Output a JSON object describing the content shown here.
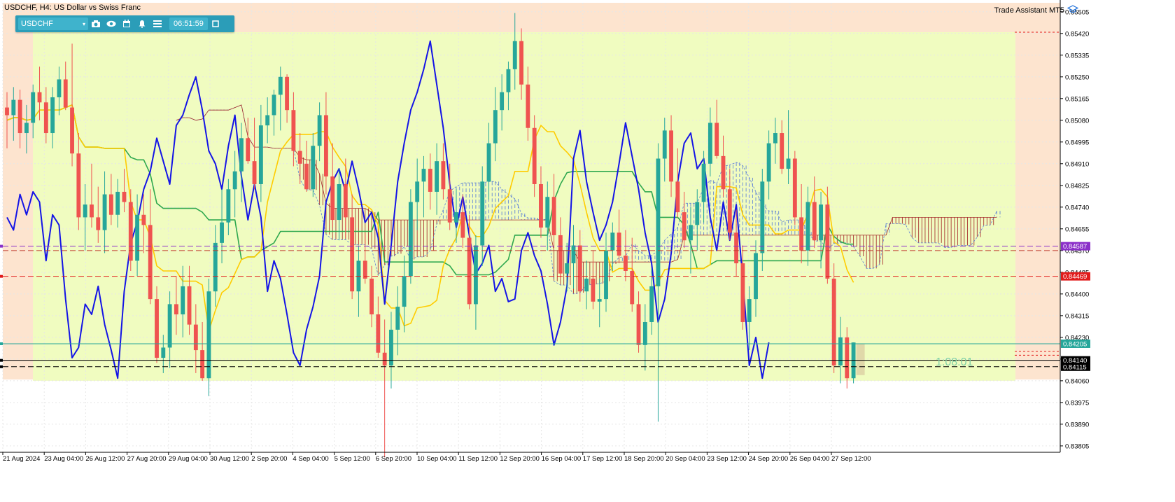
{
  "window": {
    "title": "USDCHF, H4:  US Dollar vs Swiss Franc"
  },
  "toolbar": {
    "symbol": "USDCHF",
    "dropdown_icon": "chevron-down-icon",
    "icons": [
      "camera-icon",
      "eye-icon",
      "calendar-icon",
      "bell-icon",
      "menu-icon"
    ],
    "time": "06:51:59",
    "window_icon": "restore-window-icon"
  },
  "trade_assistant": {
    "label": "Trade Assistant MT5",
    "icon": "graduation-cap-icon"
  },
  "countdown": "1:08:01",
  "colors": {
    "bull_candle": "#26a69a",
    "bear_candle": "#ef5350",
    "tenkan": "#1414e6",
    "kijun": "#ffcc00",
    "chikou": "#2fa84f",
    "kumo_bull": "#5a7fd6",
    "kumo_bear": "#a52a2a",
    "session_zone": "#fde4cf",
    "range_zone": "#f0fcc0"
  },
  "price_axis": {
    "labels": [
      "0.85505",
      "0.85420",
      "0.85335",
      "0.85250",
      "0.85165",
      "0.85080",
      "0.84995",
      "0.84910",
      "0.84825",
      "0.84740",
      "0.84655",
      "0.84570",
      "0.84485",
      "0.84400",
      "0.84315",
      "0.84230",
      "0.84145",
      "0.84060",
      "0.83975",
      "0.83890",
      "0.83805"
    ],
    "price_tags": [
      {
        "text": "0.84587",
        "color": "#8b30c9"
      },
      {
        "text": "0.84469",
        "color": "#e11b1b"
      },
      {
        "text": "0.84205",
        "color": "#26a69a"
      },
      {
        "text": "0.84140",
        "color": "#000000"
      },
      {
        "text": "0.84115",
        "color": "#000000"
      }
    ]
  },
  "time_axis": {
    "labels": [
      "21 Aug 2024",
      "23 Aug 04:00",
      "26 Aug 12:00",
      "27 Aug 20:00",
      "29 Aug 04:00",
      "30 Aug 12:00",
      "2 Sep 20:00",
      "4 Sep 04:00",
      "5 Sep 12:00",
      "6 Sep 20:00",
      "10 Sep 04:00",
      "11 Sep 12:00",
      "12 Sep 20:00",
      "16 Sep 04:00",
      "17 Sep 12:00",
      "18 Sep 20:00",
      "20 Sep 04:00",
      "23 Sep 12:00",
      "24 Sep 20:00",
      "26 Sep 04:00",
      "27 Sep 12:00"
    ]
  },
  "chart_data": {
    "type": "candlestick",
    "symbol": "USDCHF",
    "timeframe": "H4",
    "ylim": [
      0.8378,
      0.8554
    ],
    "candle_count": 131,
    "ohlc": [
      [
        0.8513,
        0.8519,
        0.8497,
        0.851
      ],
      [
        0.851,
        0.8521,
        0.85,
        0.8516
      ],
      [
        0.8516,
        0.852,
        0.8497,
        0.8503
      ],
      [
        0.8503,
        0.8514,
        0.8495,
        0.8507
      ],
      [
        0.8507,
        0.8522,
        0.8501,
        0.8519
      ],
      [
        0.8519,
        0.8529,
        0.8508,
        0.8515
      ],
      [
        0.8515,
        0.8521,
        0.8499,
        0.8503
      ],
      [
        0.8503,
        0.8521,
        0.8497,
        0.8517
      ],
      [
        0.8517,
        0.8529,
        0.851,
        0.8524
      ],
      [
        0.8524,
        0.8531,
        0.8512,
        0.8513
      ],
      [
        0.8513,
        0.8538,
        0.849,
        0.8495
      ],
      [
        0.8495,
        0.8503,
        0.8465,
        0.847
      ],
      [
        0.847,
        0.8483,
        0.8457,
        0.8475
      ],
      [
        0.8475,
        0.8491,
        0.8466,
        0.847
      ],
      [
        0.847,
        0.8482,
        0.846,
        0.8465
      ],
      [
        0.8465,
        0.8488,
        0.8456,
        0.8479
      ],
      [
        0.8479,
        0.8487,
        0.8467,
        0.8471
      ],
      [
        0.8471,
        0.8485,
        0.8466,
        0.848
      ],
      [
        0.848,
        0.8489,
        0.8472,
        0.8476
      ],
      [
        0.8476,
        0.8481,
        0.8449,
        0.8453
      ],
      [
        0.8453,
        0.8479,
        0.8447,
        0.8471
      ],
      [
        0.8471,
        0.8479,
        0.8456,
        0.8467
      ],
      [
        0.8467,
        0.8481,
        0.8436,
        0.8438
      ],
      [
        0.8438,
        0.8443,
        0.8413,
        0.8415
      ],
      [
        0.8415,
        0.8424,
        0.8409,
        0.8419
      ],
      [
        0.8419,
        0.8441,
        0.8411,
        0.8436
      ],
      [
        0.8436,
        0.8447,
        0.8424,
        0.8432
      ],
      [
        0.8432,
        0.8451,
        0.8423,
        0.8443
      ],
      [
        0.8443,
        0.8451,
        0.8424,
        0.8428
      ],
      [
        0.8428,
        0.8436,
        0.8409,
        0.8418
      ],
      [
        0.8418,
        0.8429,
        0.8406,
        0.8407
      ],
      [
        0.8407,
        0.8446,
        0.84,
        0.8441
      ],
      [
        0.8441,
        0.8467,
        0.8435,
        0.846
      ],
      [
        0.846,
        0.8481,
        0.8452,
        0.8468
      ],
      [
        0.8468,
        0.8485,
        0.8463,
        0.8481
      ],
      [
        0.8481,
        0.8496,
        0.847,
        0.8488
      ],
      [
        0.8488,
        0.8507,
        0.8476,
        0.8501
      ],
      [
        0.8501,
        0.8509,
        0.8491,
        0.8492
      ],
      [
        0.8492,
        0.8509,
        0.8481,
        0.8483
      ],
      [
        0.8483,
        0.8514,
        0.8476,
        0.8506
      ],
      [
        0.8506,
        0.8517,
        0.8499,
        0.851
      ],
      [
        0.851,
        0.852,
        0.8502,
        0.8518
      ],
      [
        0.8518,
        0.8529,
        0.8504,
        0.8525
      ],
      [
        0.8525,
        0.8526,
        0.8507,
        0.8512
      ],
      [
        0.8512,
        0.8519,
        0.849,
        0.8496
      ],
      [
        0.8496,
        0.8503,
        0.8483,
        0.8491
      ],
      [
        0.8491,
        0.85,
        0.848,
        0.8481
      ],
      [
        0.8481,
        0.8503,
        0.8478,
        0.8498
      ],
      [
        0.8498,
        0.8515,
        0.8492,
        0.851
      ],
      [
        0.851,
        0.8519,
        0.8479,
        0.8486
      ],
      [
        0.8486,
        0.8499,
        0.8466,
        0.8469
      ],
      [
        0.8469,
        0.8489,
        0.8461,
        0.8483
      ],
      [
        0.8483,
        0.8493,
        0.8462,
        0.847
      ],
      [
        0.847,
        0.8479,
        0.8438,
        0.8441
      ],
      [
        0.8441,
        0.8459,
        0.8431,
        0.8453
      ],
      [
        0.8453,
        0.8464,
        0.8444,
        0.8446
      ],
      [
        0.8446,
        0.8451,
        0.8427,
        0.8432
      ],
      [
        0.8432,
        0.8439,
        0.8415,
        0.8417
      ],
      [
        0.8417,
        0.843,
        0.8376,
        0.8412
      ],
      [
        0.8412,
        0.8433,
        0.8403,
        0.8426
      ],
      [
        0.8426,
        0.8443,
        0.8416,
        0.8435
      ],
      [
        0.8435,
        0.8455,
        0.8425,
        0.8447
      ],
      [
        0.8447,
        0.8481,
        0.8444,
        0.8476
      ],
      [
        0.8476,
        0.8493,
        0.8465,
        0.8484
      ],
      [
        0.8484,
        0.8494,
        0.847,
        0.8489
      ],
      [
        0.8489,
        0.8495,
        0.8473,
        0.848
      ],
      [
        0.848,
        0.8499,
        0.8471,
        0.8492
      ],
      [
        0.8492,
        0.8499,
        0.8477,
        0.8481
      ],
      [
        0.8481,
        0.8491,
        0.8465,
        0.8468
      ],
      [
        0.8468,
        0.8481,
        0.846,
        0.8472
      ],
      [
        0.8472,
        0.8479,
        0.8458,
        0.8462
      ],
      [
        0.8462,
        0.8471,
        0.8434,
        0.8436
      ],
      [
        0.8436,
        0.8463,
        0.8426,
        0.8459
      ],
      [
        0.8459,
        0.849,
        0.8451,
        0.8484
      ],
      [
        0.8484,
        0.8507,
        0.8477,
        0.8499
      ],
      [
        0.8499,
        0.8521,
        0.8492,
        0.8512
      ],
      [
        0.8512,
        0.8526,
        0.8504,
        0.8519
      ],
      [
        0.8519,
        0.8531,
        0.8512,
        0.8528
      ],
      [
        0.8528,
        0.855,
        0.852,
        0.8539
      ],
      [
        0.8539,
        0.8544,
        0.8516,
        0.8522
      ],
      [
        0.8522,
        0.8529,
        0.85,
        0.8505
      ],
      [
        0.8505,
        0.851,
        0.8478,
        0.8483
      ],
      [
        0.8483,
        0.849,
        0.8462,
        0.8466
      ],
      [
        0.8466,
        0.8484,
        0.8457,
        0.8478
      ],
      [
        0.8478,
        0.8487,
        0.8458,
        0.8463
      ],
      [
        0.8463,
        0.847,
        0.8446,
        0.8448
      ],
      [
        0.8448,
        0.846,
        0.8441,
        0.8452
      ],
      [
        0.8452,
        0.8467,
        0.8442,
        0.8459
      ],
      [
        0.8459,
        0.8465,
        0.8437,
        0.8441
      ],
      [
        0.8441,
        0.8453,
        0.8434,
        0.8446
      ],
      [
        0.8446,
        0.8457,
        0.8434,
        0.8437
      ],
      [
        0.8437,
        0.8446,
        0.8427,
        0.8438
      ],
      [
        0.8438,
        0.8464,
        0.8433,
        0.8457
      ],
      [
        0.8457,
        0.8468,
        0.8449,
        0.8464
      ],
      [
        0.8464,
        0.8473,
        0.8452,
        0.8455
      ],
      [
        0.8455,
        0.8465,
        0.8445,
        0.8449
      ],
      [
        0.8449,
        0.8462,
        0.8433,
        0.8436
      ],
      [
        0.8436,
        0.8441,
        0.8417,
        0.842
      ],
      [
        0.842,
        0.8436,
        0.841,
        0.8429
      ],
      [
        0.8429,
        0.845,
        0.8424,
        0.8443
      ],
      [
        0.8443,
        0.8499,
        0.839,
        0.8493
      ],
      [
        0.8493,
        0.8509,
        0.8484,
        0.8504
      ],
      [
        0.8504,
        0.851,
        0.8478,
        0.8484
      ],
      [
        0.8484,
        0.8497,
        0.847,
        0.8472
      ],
      [
        0.8472,
        0.848,
        0.8458,
        0.8461
      ],
      [
        0.8461,
        0.8474,
        0.8448,
        0.8467
      ],
      [
        0.8467,
        0.8481,
        0.8457,
        0.8476
      ],
      [
        0.8476,
        0.8496,
        0.8468,
        0.8491
      ],
      [
        0.8491,
        0.8513,
        0.8486,
        0.8507
      ],
      [
        0.8507,
        0.8516,
        0.8493,
        0.8494
      ],
      [
        0.8494,
        0.8502,
        0.8478,
        0.8481
      ],
      [
        0.8481,
        0.8489,
        0.8461,
        0.8464
      ],
      [
        0.8464,
        0.8473,
        0.8447,
        0.8452
      ],
      [
        0.8452,
        0.8459,
        0.8426,
        0.8429
      ],
      [
        0.8429,
        0.8443,
        0.8418,
        0.8438
      ],
      [
        0.8438,
        0.8461,
        0.8431,
        0.8456
      ],
      [
        0.8456,
        0.8489,
        0.8449,
        0.8484
      ],
      [
        0.8484,
        0.8504,
        0.8477,
        0.8499
      ],
      [
        0.8499,
        0.8509,
        0.8491,
        0.8503
      ],
      [
        0.8503,
        0.8508,
        0.8487,
        0.8489
      ],
      [
        0.8489,
        0.8512,
        0.8483,
        0.8493
      ],
      [
        0.8493,
        0.8496,
        0.8467,
        0.847
      ],
      [
        0.847,
        0.8483,
        0.8452,
        0.8457
      ],
      [
        0.8457,
        0.8482,
        0.8451,
        0.8476
      ],
      [
        0.8476,
        0.8486,
        0.8458,
        0.8461
      ],
      [
        0.8461,
        0.848,
        0.845,
        0.8475
      ],
      [
        0.8475,
        0.8482,
        0.8444,
        0.8446
      ],
      [
        0.8446,
        0.8452,
        0.8409,
        0.8412
      ],
      [
        0.8412,
        0.8431,
        0.8405,
        0.8423
      ],
      [
        0.8423,
        0.8427,
        0.8403,
        0.8407
      ],
      [
        0.8407,
        0.8421,
        0.8405,
        0.8421
      ]
    ],
    "levels": [
      {
        "price": 0.84587,
        "color": "#8b30c9",
        "style": "dashed"
      },
      {
        "price": 0.84469,
        "color": "#e11b1b",
        "style": "dashed"
      },
      {
        "price": 0.84205,
        "color": "#26a69a",
        "style": "solid"
      },
      {
        "price": 0.8414,
        "color": "#000000",
        "style": "solid"
      },
      {
        "price": 0.84115,
        "color": "#000000",
        "style": "dashed"
      }
    ]
  }
}
